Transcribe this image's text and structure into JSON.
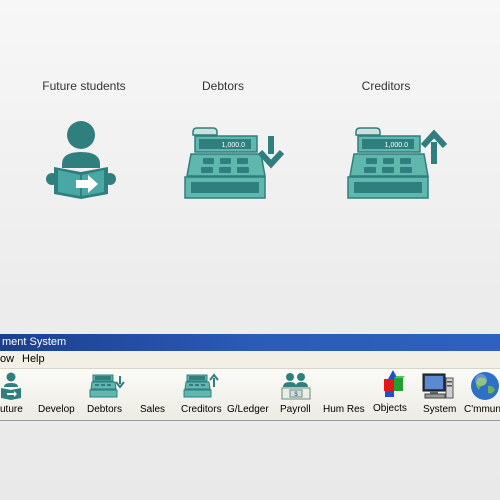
{
  "showcase": {
    "items": [
      {
        "label": "Future students",
        "icon": "reading-person-icon"
      },
      {
        "label": "Debtors",
        "icon": "cash-register-down-icon",
        "display": "1,000.0"
      },
      {
        "label": "Creditors",
        "icon": "cash-register-up-icon",
        "display": "1,000.0"
      }
    ],
    "accent": "#2f7f7f"
  },
  "window": {
    "title": "ment System",
    "menu": [
      "ow",
      "Help"
    ],
    "toolbar": [
      {
        "label": "uture",
        "icon": "reading-person-icon"
      },
      {
        "label": "Develop",
        "icon": ""
      },
      {
        "label": "Debtors",
        "icon": "cash-register-down-icon"
      },
      {
        "label": "Sales",
        "icon": ""
      },
      {
        "label": "Creditors",
        "icon": "cash-register-up-icon"
      },
      {
        "label": "G/Ledger",
        "icon": ""
      },
      {
        "label": "Payroll",
        "icon": "payroll-people-icon"
      },
      {
        "label": "Hum Res",
        "icon": ""
      },
      {
        "label": "Objects",
        "icon": "objects-shapes-icon"
      },
      {
        "label": "System",
        "icon": "computer-icon"
      },
      {
        "label": "C'mmunic",
        "icon": "globe-icon"
      }
    ]
  }
}
